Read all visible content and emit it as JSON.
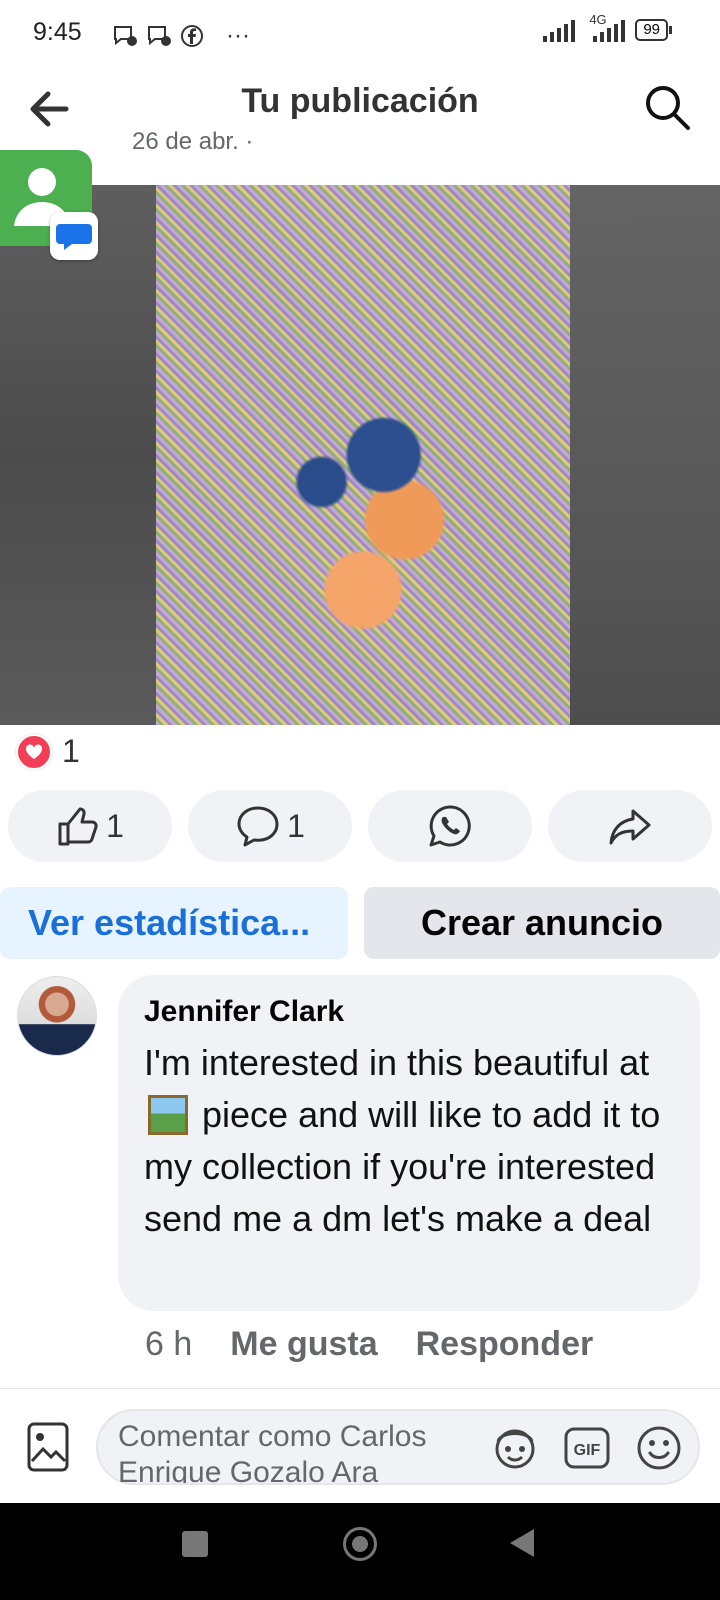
{
  "status_bar": {
    "time": "9:45",
    "more": "···",
    "network": "4G",
    "battery": "99"
  },
  "header": {
    "title": "Tu publicación"
  },
  "post": {
    "date": "26 de abr. ·"
  },
  "reactions": {
    "count": "1"
  },
  "actions": {
    "like_count": "1",
    "comment_count": "1"
  },
  "buttons": {
    "stats": "Ver estadística...",
    "create_ad": "Crear anuncio"
  },
  "comment": {
    "author": "Jennifer Clark",
    "text_part1": "I'm interested in this beautiful at",
    "text_part2": "piece and will like to add it to my collection if you're interested send me a dm let's make a deal",
    "time": "6 h",
    "like_label": "Me gusta",
    "reply_label": "Responder"
  },
  "composer": {
    "placeholder": "Comentar como Carlos Enrique Gozalo Ara"
  },
  "colors": {
    "accent": "#1b6fd8",
    "reaction_heart": "#f33e58",
    "bubble_bg": "#f0f2f5"
  }
}
